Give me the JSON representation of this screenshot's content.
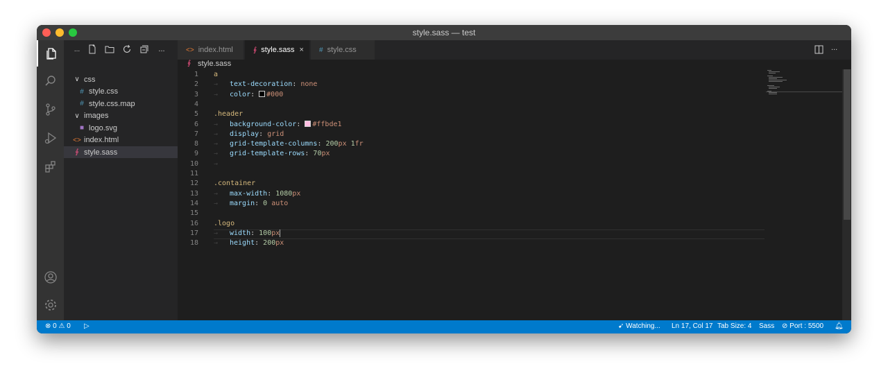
{
  "window": {
    "title": "style.sass — test"
  },
  "activity_bar": [
    "explorer-icon",
    "search-icon",
    "source-control-icon",
    "run-debug-icon",
    "extensions-icon",
    "account-icon",
    "settings-gear-icon"
  ],
  "sidebar": {
    "toolbar_label": "...",
    "more_label": "...",
    "tree": [
      {
        "label": "css",
        "type": "folder",
        "depth": 0,
        "icon": "chevron-down-icon",
        "glyph": "∨"
      },
      {
        "label": "style.css",
        "type": "file",
        "depth": 1,
        "icon": "css-file-icon",
        "glyph": "#"
      },
      {
        "label": "style.css.map",
        "type": "file",
        "depth": 1,
        "icon": "css-file-icon",
        "glyph": "#"
      },
      {
        "label": "images",
        "type": "folder",
        "depth": 0,
        "icon": "chevron-down-icon",
        "glyph": "∨"
      },
      {
        "label": "logo.svg",
        "type": "file",
        "depth": 1,
        "icon": "svg-file-icon",
        "glyph": "■"
      },
      {
        "label": "index.html",
        "type": "file",
        "depth": 0,
        "icon": "html-file-icon",
        "glyph": "<>"
      },
      {
        "label": "style.sass",
        "type": "file",
        "depth": 0,
        "icon": "sass-file-icon",
        "glyph": "∮",
        "selected": true
      }
    ]
  },
  "tabs": [
    {
      "label": "index.html",
      "glyph": "<>",
      "color": "#e37933",
      "active": false
    },
    {
      "label": "style.sass",
      "glyph": "∮",
      "color": "#f55385",
      "active": true,
      "close": "×"
    },
    {
      "label": "style.css",
      "glyph": "#",
      "color": "#519aba",
      "active": false
    }
  ],
  "breadcrumb": {
    "glyph": "∮",
    "file": "style.sass"
  },
  "code_lines": [
    {
      "n": "1",
      "tokens": [
        {
          "t": "a",
          "c": "sel"
        }
      ]
    },
    {
      "n": "2",
      "guide": true,
      "tokens": [
        {
          "t": "text-decoration",
          "c": "prop"
        },
        {
          "t": ": ",
          "c": ""
        },
        {
          "t": "none",
          "c": "val"
        }
      ]
    },
    {
      "n": "3",
      "guide": true,
      "tokens": [
        {
          "t": "color",
          "c": "prop"
        },
        {
          "t": ": ",
          "c": ""
        },
        {
          "swatch": "#000000"
        },
        {
          "t": "#000",
          "c": "val"
        }
      ]
    },
    {
      "n": "4",
      "tokens": []
    },
    {
      "n": "5",
      "tokens": [
        {
          "t": ".header",
          "c": "sel"
        }
      ]
    },
    {
      "n": "6",
      "guide": true,
      "tokens": [
        {
          "t": "background-color",
          "c": "prop"
        },
        {
          "t": ": ",
          "c": ""
        },
        {
          "swatch": "#ffbde1"
        },
        {
          "t": "#ffbde1",
          "c": "val"
        }
      ]
    },
    {
      "n": "7",
      "guide": true,
      "tokens": [
        {
          "t": "display",
          "c": "prop"
        },
        {
          "t": ": ",
          "c": ""
        },
        {
          "t": "grid",
          "c": "val"
        }
      ]
    },
    {
      "n": "8",
      "guide": true,
      "tokens": [
        {
          "t": "grid-template-columns",
          "c": "prop"
        },
        {
          "t": ": ",
          "c": ""
        },
        {
          "t": "200",
          "c": "num"
        },
        {
          "t": "px ",
          "c": "unit"
        },
        {
          "t": "1",
          "c": "num"
        },
        {
          "t": "fr",
          "c": "unit"
        }
      ]
    },
    {
      "n": "9",
      "guide": true,
      "tokens": [
        {
          "t": "grid-template-rows",
          "c": "prop"
        },
        {
          "t": ": ",
          "c": ""
        },
        {
          "t": "70",
          "c": "num"
        },
        {
          "t": "px",
          "c": "unit"
        }
      ]
    },
    {
      "n": "10",
      "guide": true,
      "tokens": []
    },
    {
      "n": "11",
      "tokens": []
    },
    {
      "n": "12",
      "tokens": [
        {
          "t": ".container",
          "c": "sel"
        }
      ]
    },
    {
      "n": "13",
      "guide": true,
      "tokens": [
        {
          "t": "max-width",
          "c": "prop"
        },
        {
          "t": ": ",
          "c": ""
        },
        {
          "t": "1080",
          "c": "num"
        },
        {
          "t": "px",
          "c": "unit"
        }
      ]
    },
    {
      "n": "14",
      "guide": true,
      "tokens": [
        {
          "t": "margin",
          "c": "prop"
        },
        {
          "t": ": ",
          "c": ""
        },
        {
          "t": "0",
          "c": "num"
        },
        {
          "t": " auto",
          "c": "val"
        }
      ]
    },
    {
      "n": "15",
      "tokens": []
    },
    {
      "n": "16",
      "tokens": [
        {
          "t": ".logo",
          "c": "sel"
        }
      ]
    },
    {
      "n": "17",
      "guide": true,
      "tokens": [
        {
          "t": "width",
          "c": "prop"
        },
        {
          "t": ": ",
          "c": ""
        },
        {
          "t": "100",
          "c": "num"
        },
        {
          "t": "px",
          "c": "unit"
        }
      ]
    },
    {
      "n": "18",
      "guide": true,
      "tokens": [
        {
          "t": "height",
          "c": "prop"
        },
        {
          "t": ": ",
          "c": ""
        },
        {
          "t": "200",
          "c": "num"
        },
        {
          "t": "px",
          "c": "unit"
        }
      ]
    }
  ],
  "statusbar": {
    "errors": "0",
    "warnings": "0",
    "watching": "Watching...",
    "position": "Ln 17, Col 17",
    "tab_size": "Tab Size: 4",
    "language": "Sass",
    "port": "Port : 5500"
  },
  "colors": {
    "accent": "#007acc",
    "editor_bg": "#1e1e1e",
    "sidebar_bg": "#252526"
  }
}
